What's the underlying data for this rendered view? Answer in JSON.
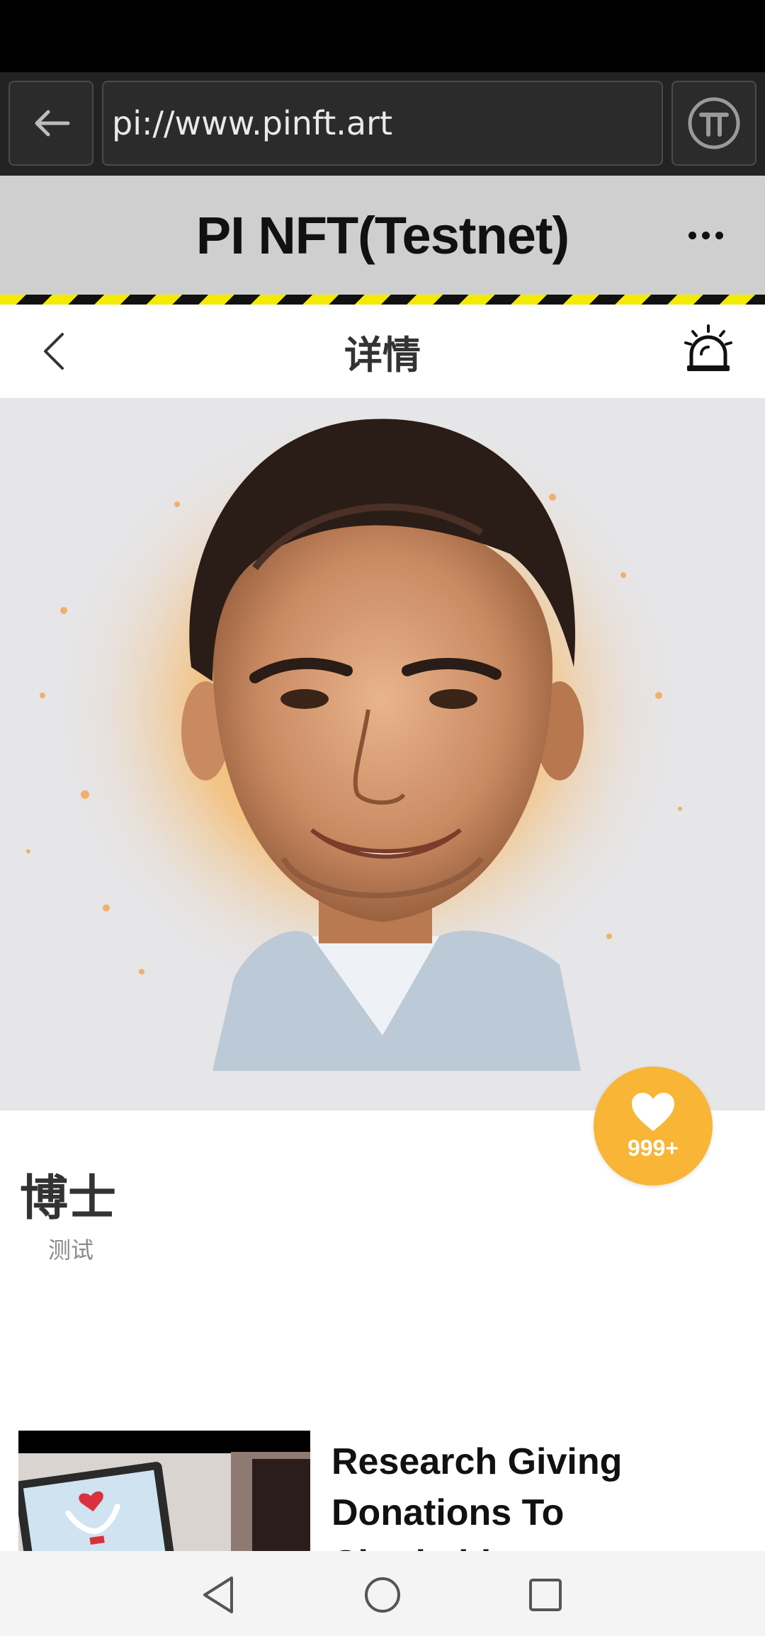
{
  "browser": {
    "url": "pi://www.pinft.art",
    "back_icon": "arrow-left-icon",
    "pi_icon": "pi-logo-icon"
  },
  "app": {
    "title": "PI NFT(Testnet)",
    "menu_icon": "more-dots-icon"
  },
  "nav": {
    "title": "详情",
    "back_icon": "chevron-left-icon",
    "alarm_icon": "alarm-siren-icon"
  },
  "nft": {
    "name": "博士",
    "subtitle": "测试",
    "likes": "999+",
    "like_icon": "heart-icon",
    "accent": "#f8b536"
  },
  "article": {
    "title": "Research Giving Donations To Charitable"
  },
  "system_nav": {
    "back_icon": "triangle-back-icon",
    "home_icon": "circle-home-icon",
    "recents_icon": "square-recents-icon"
  }
}
